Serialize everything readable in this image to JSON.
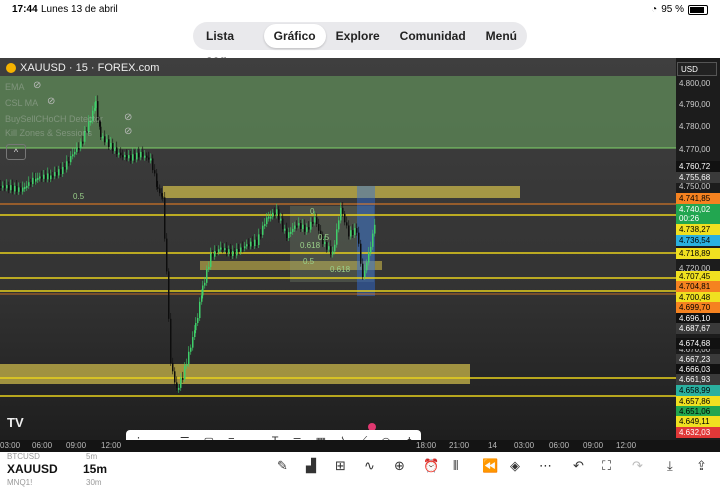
{
  "status": {
    "time": "17:44",
    "date": "Lunes 13 de abril",
    "battery": "95 %"
  },
  "nav": {
    "tabs": [
      "Lista seg.",
      "Gráfico",
      "Explore",
      "Comunidad",
      "Menú"
    ],
    "active": "Gráfico"
  },
  "chart": {
    "symbol": "XAUUSD · 15 · FOREX.com",
    "currency": "USD",
    "indicators": [
      "EMA",
      "CSL MA",
      "BuySellCHoCH Detector",
      "Kill Zones & Sessions"
    ],
    "fib_labels": [
      "0.5",
      "0",
      "0.5",
      "0.618",
      "0.5",
      "0.618"
    ],
    "colors": {
      "support_band": "#c9b74a",
      "up_candle": "#3fcf6a",
      "down_candle": "#111111",
      "level_line": "#e8d21c",
      "accent": "#2962ff"
    }
  },
  "price_axis": {
    "plain": [
      "4.800,00",
      "4.790,00",
      "4.780,00",
      "4.770,00",
      "4.750,00",
      "4.720,00",
      "4.670,00"
    ],
    "labels": [
      {
        "text": "4.760,72",
        "bg": "#111111",
        "fg": "#ffffff"
      },
      {
        "text": "4.755,68",
        "bg": "#3a3a3a",
        "fg": "#ffffff"
      },
      {
        "text": "4.741,85",
        "bg": "#f58220",
        "fg": "#000000"
      },
      {
        "text": "4.740,02",
        "bg": "#22a650",
        "fg": "#ffffff"
      },
      {
        "text": "00:26",
        "bg": "#22a650",
        "fg": "#ffffff"
      },
      {
        "text": "4.738,27",
        "bg": "#f0e020",
        "fg": "#000000"
      },
      {
        "text": "4.736,54",
        "bg": "#2ab0e0",
        "fg": "#000000"
      },
      {
        "text": "4.718,89",
        "bg": "#f0e020",
        "fg": "#000000"
      },
      {
        "text": "4.707,45",
        "bg": "#f0e020",
        "fg": "#000000"
      },
      {
        "text": "4.704,81",
        "bg": "#f58220",
        "fg": "#000000"
      },
      {
        "text": "4.700,48",
        "bg": "#f0e020",
        "fg": "#000000"
      },
      {
        "text": "4.699,70",
        "bg": "#f58220",
        "fg": "#000000"
      },
      {
        "text": "4.696,10",
        "bg": "#111111",
        "fg": "#ffffff"
      },
      {
        "text": "4.687,67",
        "bg": "#3a3a3a",
        "fg": "#ffffff"
      },
      {
        "text": "4.674,68",
        "bg": "#111111",
        "fg": "#ffffff"
      },
      {
        "text": "4.667,23",
        "bg": "#3a3a3a",
        "fg": "#ffffff"
      },
      {
        "text": "4.666,03",
        "bg": "#111111",
        "fg": "#ffffff"
      },
      {
        "text": "4.661,93",
        "bg": "#3a3a3a",
        "fg": "#ffffff"
      },
      {
        "text": "4.658,99",
        "bg": "#2ab0a0",
        "fg": "#000000"
      },
      {
        "text": "4.657,86",
        "bg": "#f0e020",
        "fg": "#000000"
      },
      {
        "text": "4.651,06",
        "bg": "#22a650",
        "fg": "#000000"
      },
      {
        "text": "4.649,11",
        "bg": "#f0e020",
        "fg": "#000000"
      },
      {
        "text": "4.632,03",
        "bg": "#e03838",
        "fg": "#ffffff"
      }
    ]
  },
  "time_axis": [
    "03:00",
    "06:00",
    "09:00",
    "12:00",
    "18:00",
    "21:00",
    "14",
    "03:00",
    "06:00",
    "09:00",
    "12:00"
  ],
  "drawing_tools": [
    "horizontal-line",
    "parallel-channel",
    "rectangle",
    "fib",
    "ray",
    "text",
    "notes",
    "grid",
    "path",
    "trend-line",
    "circle",
    "pitchfork"
  ],
  "bottom": {
    "symbol": "XAUUSD",
    "timeframe": "15m",
    "watch1": "BTCUSD",
    "watch1_tf": "5m",
    "watch2": "MNQ1!",
    "watch2_tf": "30m",
    "logo": "TV"
  }
}
